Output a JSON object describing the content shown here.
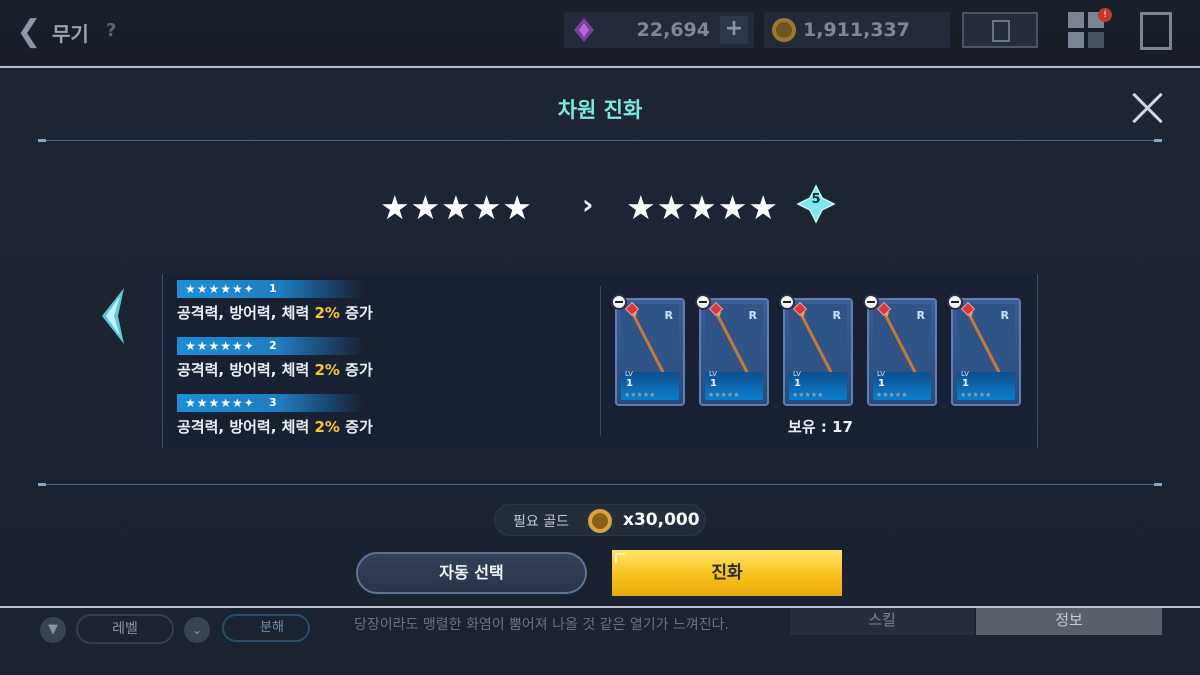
{
  "topbar": {
    "title": "무기",
    "help": "?",
    "gem_amount": "22,694",
    "plus": "+",
    "gold_amount": "1,911,337",
    "notification": "!"
  },
  "background": {
    "filter_icon": "▼",
    "level_filter": "레벨",
    "sort_icon": "⌄",
    "dismantle": "분해",
    "flavor_text": "당장이라도 맹렬한 화염이 뿜어져 나올 것 같은 열기가 느껴진다.",
    "tab_skill": "스킬",
    "tab_info": "정보"
  },
  "modal": {
    "title": "차원 진화",
    "from_stars": "★★★★★",
    "arrow": "›",
    "to_stars": "★★★★★",
    "to_badge": "5",
    "bonuses": [
      {
        "tier": "1",
        "stars": "★★★★★✦",
        "text_prefix": "공격력, 방어력, 체력 ",
        "pct": "2%",
        "text_suffix": " 증가"
      },
      {
        "tier": "2",
        "stars": "★★★★★✦",
        "text_prefix": "공격력, 방어력, 체력 ",
        "pct": "2%",
        "text_suffix": " 증가"
      },
      {
        "tier": "3",
        "stars": "★★★★★✦",
        "text_prefix": "공격력, 방어력, 체력 ",
        "pct": "2%",
        "text_suffix": " 증가"
      }
    ],
    "cards": [
      {
        "rank": "R",
        "lv_label": "LV",
        "lv": "1",
        "stars": "★★★★★"
      },
      {
        "rank": "R",
        "lv_label": "LV",
        "lv": "1",
        "stars": "★★★★★"
      },
      {
        "rank": "R",
        "lv_label": "LV",
        "lv": "1",
        "stars": "★★★★★"
      },
      {
        "rank": "R",
        "lv_label": "LV",
        "lv": "1",
        "stars": "★★★★★"
      },
      {
        "rank": "R",
        "lv_label": "LV",
        "lv": "1",
        "stars": "★★★★★"
      }
    ],
    "owned": "보유 : 17",
    "required_gold_label": "필요 골드",
    "required_gold_amount": "x30,000",
    "auto_select": "자동 선택",
    "evolve": "진화"
  },
  "colors": {
    "title_accent": "#7ee8e2",
    "percent_highlight": "#f6c636",
    "evolve_button": "#f7c21a",
    "tier_tag": "#1c8fd6"
  },
  "icons": [
    "back-arrow-icon",
    "help-icon",
    "gem-icon",
    "gold-coin-icon",
    "memo-icon",
    "grid-menu-icon",
    "exit-door-icon",
    "close-icon",
    "left-arrow-icon",
    "remove-icon",
    "spear-icon",
    "star-badge-icon"
  ]
}
